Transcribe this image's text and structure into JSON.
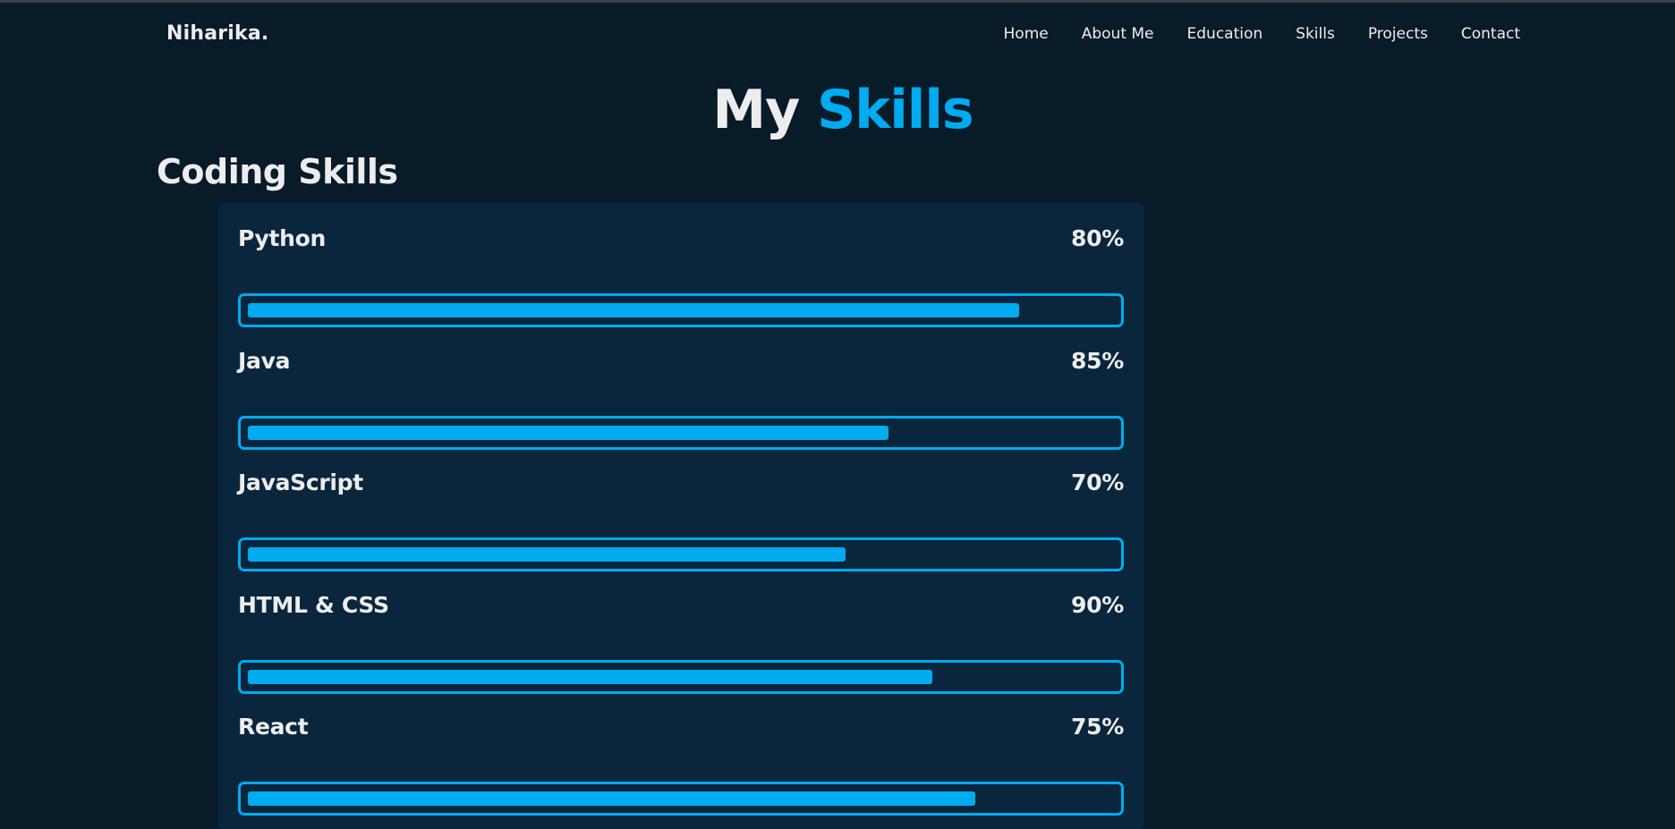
{
  "header": {
    "logo": "Niharika.",
    "nav": [
      "Home",
      "About Me",
      "Education",
      "Skills",
      "Projects",
      "Contact"
    ]
  },
  "heading": {
    "main": "My",
    "accent": "Skills"
  },
  "section": {
    "title": "Coding Skills"
  },
  "skills": [
    {
      "name": "Python",
      "percent_label": "80%",
      "bar_fill": 0.89
    },
    {
      "name": "Java",
      "percent_label": "85%",
      "bar_fill": 0.74
    },
    {
      "name": "JavaScript",
      "percent_label": "70%",
      "bar_fill": 0.69
    },
    {
      "name": "HTML & CSS",
      "percent_label": "90%",
      "bar_fill": 0.79
    },
    {
      "name": "React",
      "percent_label": "75%",
      "bar_fill": 0.84
    }
  ],
  "colors": {
    "background": "#081b29",
    "panel": "#0a263d",
    "accent": "#00abf0",
    "text": "#ededed"
  }
}
